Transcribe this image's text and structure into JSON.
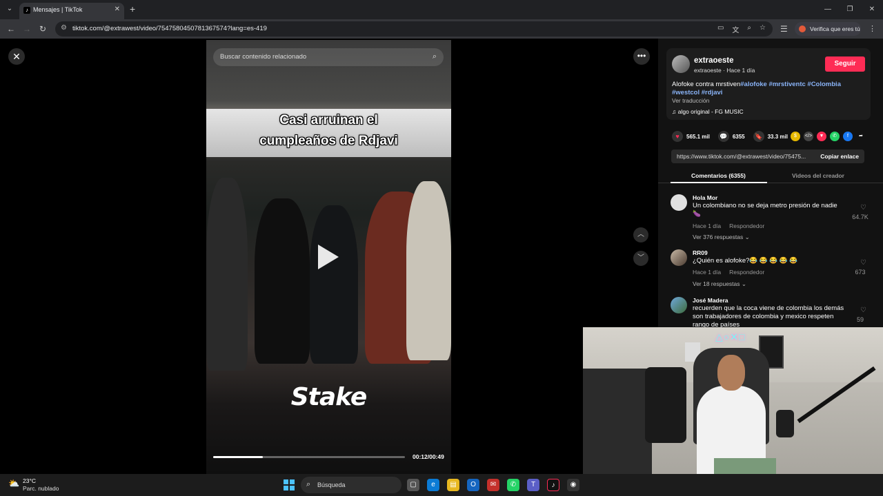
{
  "browser": {
    "tab_title": "Mensajes | TikTok",
    "url": "tiktok.com/@extrawest/video/7547580450781367574?lang=es-419",
    "verify_label": "Verifica que eres tú"
  },
  "video": {
    "search_placeholder": "Buscar contenido relacionado",
    "caption_line1": "Casi arruinan el",
    "caption_line2": "cumpleaños de Rdjavi",
    "watermark": "Stake",
    "time": "00:12/00:49",
    "progress": 0.26
  },
  "post": {
    "author": "extraoeste",
    "author_sub": "extraoeste · Hace 1 día",
    "follow_label": "Seguir",
    "desc_text": "Alofoke contra mrstiven",
    "desc_tags1": "#alofoke #mrstiventc #Colombia",
    "desc_tags2": "#westcol #rdjavi",
    "see_translation": "Ver traducción",
    "music": "algo original - FG MUSIC"
  },
  "actions": {
    "likes": "565.1 mil",
    "comments": "6355",
    "saves": "33.3 mil"
  },
  "link": {
    "url": "https://www.tiktok.com/@extrawest/video/75475...",
    "copy_label": "Copiar enlace"
  },
  "tabs": {
    "comments": "Comentarios (6355)",
    "creator_videos": "Videos del creador"
  },
  "comments": [
    {
      "name": "Hola Mor",
      "text": "Un colombiano no se deja metro presión de nadie 🍆",
      "time": "Hace 1 día",
      "reply": "Respondedor",
      "replies": "Ver 376 respuestas ⌄",
      "likes": "64.7K"
    },
    {
      "name": "RR09",
      "text": "¿Quién es alofoke?😂 😂 😂 😂 😂",
      "time": "Hace 1 día",
      "reply": "Respondedor",
      "replies": "Ver 18 respuestas ⌄",
      "likes": "673"
    },
    {
      "name": "José Madera",
      "text": "recuerden que la coca viene de colombia los demás son trabajadores de colombia y mexico respeten rango de países",
      "likes": "59"
    }
  ],
  "taskbar": {
    "temp": "23°C",
    "weather": "Parc. nublado",
    "search": "Búsqueda"
  }
}
